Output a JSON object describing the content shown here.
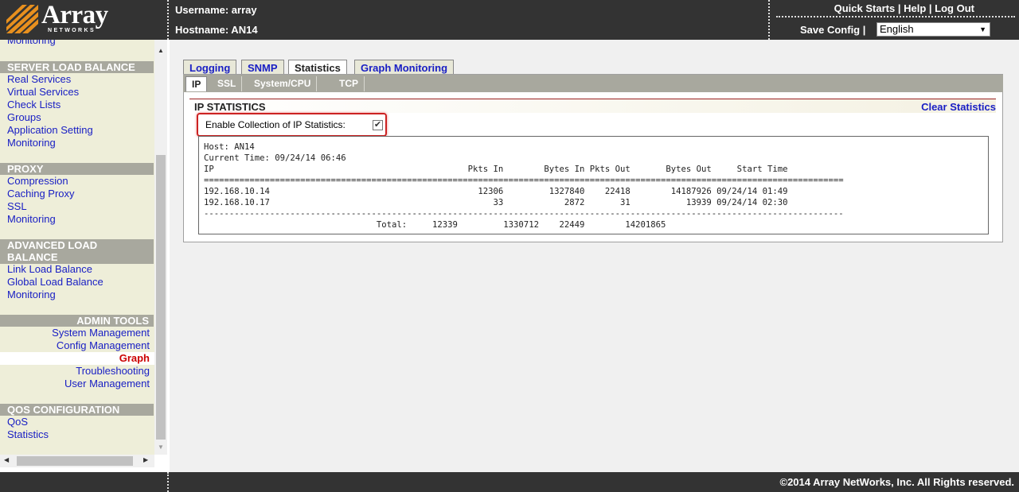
{
  "header": {
    "brand": "Array",
    "brand_sub": "NETWORKS",
    "username": "Username: array",
    "hostname": "Hostname: AN14",
    "links": [
      "Quick Starts",
      "Help",
      "Log Out"
    ],
    "separator": "|",
    "save_config": "Save Config",
    "language": "English",
    "logo_color": "#e8901e"
  },
  "sidebar": {
    "partial_item": "Monitoring",
    "sections": [
      {
        "title": "SERVER LOAD BALANCE",
        "items": [
          "Real Services",
          "Virtual Services",
          "Check Lists",
          "Groups",
          "Application Setting",
          "Monitoring"
        ]
      },
      {
        "title": "PROXY",
        "items": [
          "Compression",
          "Caching Proxy",
          "SSL",
          "Monitoring"
        ]
      },
      {
        "title": "ADVANCED LOAD BALANCE",
        "items": [
          "Link Load Balance",
          "Global Load Balance",
          "Monitoring"
        ]
      },
      {
        "title": "ADMIN TOOLS",
        "items": [
          "System Management",
          "Config Management",
          "Graph",
          "Troubleshooting",
          "User Management"
        ]
      },
      {
        "title": "QOS CONFIGURATION",
        "items": [
          "QoS",
          "Statistics"
        ]
      }
    ],
    "adv_title_line1": "ADVANCED LOAD",
    "adv_title_line2": "BALANCE",
    "active_item": "Graph",
    "colors": {
      "background": "#eeeed9",
      "section_header": "#a8a89e",
      "link": "#1a20c4",
      "active": "#cc0000"
    }
  },
  "tabs": [
    "Logging",
    "SNMP",
    "Statistics",
    "Graph Monitoring"
  ],
  "active_tab": "Statistics",
  "subtabs": [
    "IP",
    "SSL",
    "System/CPU",
    "TCP"
  ],
  "active_subtab": "IP",
  "ip_statistics": {
    "title": "IP STATISTICS",
    "clear_label": "Clear Statistics",
    "enable_label": "Enable Collection of IP Statistics:",
    "enabled": true,
    "host_line": "Host: AN14",
    "time_line": "Current Time: 09/24/14 06:46",
    "columns": [
      "IP",
      "Pkts In",
      "Bytes In",
      "Pkts Out",
      "Bytes Out",
      "Start Time"
    ],
    "rows": [
      {
        "ip": "192.168.10.14",
        "pkts_in": "12306",
        "bytes_in": "1327840",
        "pkts_out": "22418",
        "bytes_out": "14187926",
        "start": "09/24/14 01:49"
      },
      {
        "ip": "192.168.10.17",
        "pkts_in": "33",
        "bytes_in": "2872",
        "pkts_out": "31",
        "bytes_out": "13939",
        "start": "09/24/14 02:30"
      }
    ],
    "total_label": "Total:",
    "total": {
      "pkts_in": "12339",
      "bytes_in": "1330712",
      "pkts_out": "22449",
      "bytes_out": "14201865"
    }
  },
  "footer": {
    "copyright": "©2014 Array NetWorks, Inc. All Rights reserved."
  }
}
